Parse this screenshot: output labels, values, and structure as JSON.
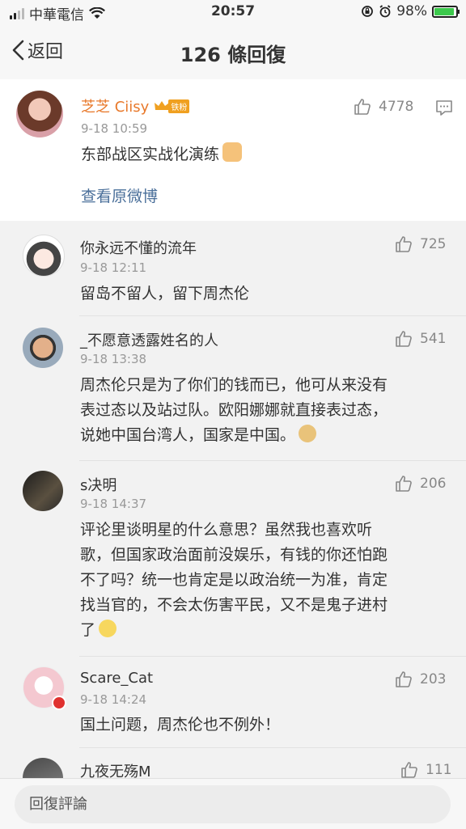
{
  "status_bar": {
    "carrier": "中華電信",
    "time": "20:57",
    "battery": "98%"
  },
  "nav": {
    "back_label": "返回",
    "title": "126 條回復"
  },
  "original": {
    "user": "芝芝 Ciisy",
    "badge": "铁粉",
    "time": "9-18 10:59",
    "text": "东部战区实战化演练",
    "likes": "4778",
    "view_original": "查看原微博"
  },
  "comments": [
    {
      "user": "你永远不懂的流年",
      "time": "9-18 12:11",
      "text": "留岛不留人，留下周杰伦",
      "likes": "725"
    },
    {
      "user": "_不愿意透露姓名的人",
      "time": "9-18 13:38",
      "lines": [
        "周杰伦只是为了你们的钱而已，他可从来没有",
        "表过态以及站过队。欧阳娜娜就直接表过态，",
        "说她中国台湾人，国家是中国。"
      ],
      "likes": "541"
    },
    {
      "user": "s决明",
      "time": "9-18 14:37",
      "lines": [
        "评论里谈明星的什么意思？虽然我也喜欢听",
        "歌，但国家政治面前没娱乐，有钱的你还怕跑",
        "不了吗？统一也肯定是以政治统一为准，肯定",
        "找当官的，不会太伤害平民，又不是鬼子进村",
        "了"
      ],
      "likes": "206"
    },
    {
      "user": "Scare_Cat",
      "time": "9-18 14:24",
      "text": "国土问题，周杰伦也不例外！",
      "likes": "203"
    },
    {
      "user": "九夜无殇M",
      "likes": "111"
    }
  ],
  "reply_placeholder": "回復評論"
}
